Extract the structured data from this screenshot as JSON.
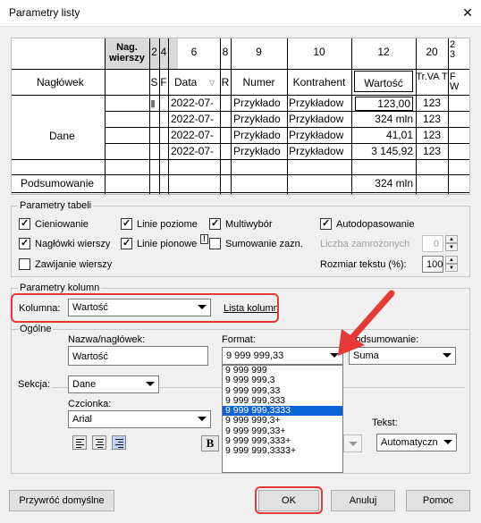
{
  "window": {
    "title": "Parametry listy",
    "close_glyph": "✕"
  },
  "preview": {
    "header_row_label": "Nagłówek",
    "data_row_label": "Dane",
    "summary_row_label": "Podsumowanie",
    "columns": {
      "nag_wierszy": "Nag. wierszy",
      "c2": "2",
      "c4": "4",
      "c6": "6",
      "c8": "8",
      "c9": "9",
      "c10": "10",
      "c12": "12",
      "c20": "20",
      "c23": "2 3",
      "s": "S",
      "f": "F",
      "data": "Data",
      "r": "R",
      "numer": "Numer",
      "kontrahent": "Kontrahent",
      "wartosc": "Wartość",
      "trvat": "Tr.VA T",
      "fw": "F W"
    },
    "rows": [
      {
        "date": "2022-07-",
        "numer": "Przykłado",
        "kontrahent": "Przykładow",
        "wartosc": "123,00",
        "trvat": "123"
      },
      {
        "date": "2022-07-",
        "numer": "Przykłado",
        "kontrahent": "Przykładow",
        "wartosc": "324 mln",
        "trvat": "123"
      },
      {
        "date": "2022-07-",
        "numer": "Przykłado",
        "kontrahent": "Przykładow",
        "wartosc": "41,01",
        "trvat": "123"
      },
      {
        "date": "2022-07-",
        "numer": "Przykłado",
        "kontrahent": "Przykładow",
        "wartosc": "3 145,92",
        "trvat": "123"
      }
    ],
    "summary_value": "324 mln"
  },
  "table_params": {
    "legend": "Parametry tabeli",
    "cieniowanie": "Cieniowanie",
    "linie_poziome": "Linie poziome",
    "multiwybor": "Multiwybór",
    "autodopasowanie": "Autodopasowanie",
    "naglowki_wierszy": "Nagłówki wierszy",
    "linie_pionowe": "Linie pionowe",
    "sumowanie": "Sumowanie zazn.",
    "liczba_zamrozonych": "Liczba zamrożonych",
    "liczba_value": "0",
    "zawijanie": "Zawijanie wierszy",
    "rozmiar": "Rozmiar tekstu (%):",
    "rozmiar_value": "100",
    "warning_glyph": "!"
  },
  "col_params": {
    "legend": "Parametry kolumn",
    "kolumna_label": "Kolumna:",
    "kolumna_value": "Wartość",
    "lista_kolumn": "Lista kolumn",
    "ogolne": "Ogólne",
    "nazwa_label": "Nazwa/nagłówek:",
    "nazwa_value": "Wartość",
    "format_label": "Format:",
    "format_value": "9 999 999,33",
    "podsumowanie_label": "Podsumowanie:",
    "podsumowanie_value": "Suma",
    "sekcja_label": "Sekcja:",
    "sekcja_value": "Dane",
    "czcionka_label": "Czcionka:",
    "czcionka_value": "Arial",
    "tekst_label": "Tekst:",
    "tekst_value": "Automatyczn",
    "bold_glyph": "B",
    "format_options": [
      "9 999 999",
      "9 999 999,3",
      "9 999 999,33",
      "9 999 999,333",
      "9 999 999,3333",
      "9 999 999,3+",
      "9 999 999,33+",
      "9 999 999,333+",
      "9 999 999,3333+"
    ]
  },
  "buttons": {
    "przywroc": "Przywróć domyślne",
    "ok": "OK",
    "anuluj": "Anuluj",
    "pomoc": "Pomoc"
  },
  "colors": {
    "highlight_red": "#e53935",
    "selection_blue": "#0a64d8"
  }
}
